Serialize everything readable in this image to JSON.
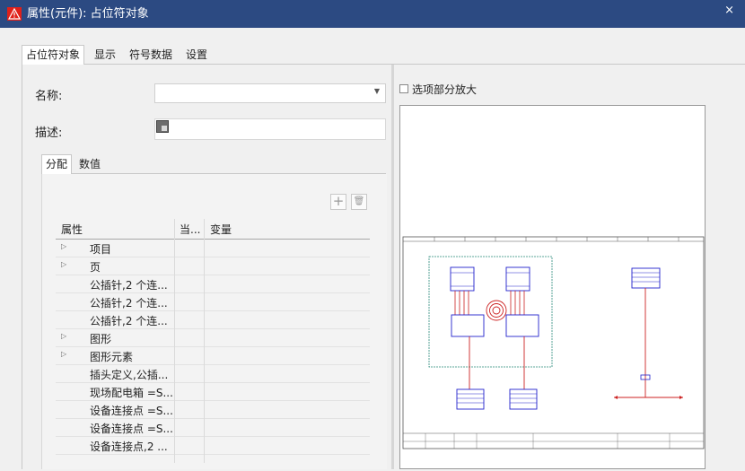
{
  "window": {
    "title": "属性(元件): 占位符对象",
    "close_glyph": "×"
  },
  "tabs": [
    {
      "label": "占位符对象",
      "active": true
    },
    {
      "label": "显示"
    },
    {
      "label": "符号数据"
    },
    {
      "label": "设置"
    }
  ],
  "form": {
    "name_label": "名称:",
    "name_value": "",
    "description_label": "描述:",
    "description_value": ""
  },
  "subtabs": [
    {
      "label": "分配",
      "active": true
    },
    {
      "label": "数值"
    }
  ],
  "toolbar": {
    "add_glyph": "+",
    "delete_glyph": "🗑"
  },
  "grid": {
    "headers": [
      "属性",
      "当...",
      "变量"
    ],
    "rows": [
      {
        "label": "项目",
        "expandable": true
      },
      {
        "label": "页",
        "expandable": true
      },
      {
        "label": "公插针,2 个连..."
      },
      {
        "label": "公插针,2 个连..."
      },
      {
        "label": "公插针,2 个连..."
      },
      {
        "label": "图形",
        "expandable": true
      },
      {
        "label": "图形元素",
        "expandable": true
      },
      {
        "label": "插头定义,公插..."
      },
      {
        "label": "现场配电箱 =S..."
      },
      {
        "label": "设备连接点 =S..."
      },
      {
        "label": "设备连接点 =S..."
      },
      {
        "label": "设备连接点,2 ..."
      }
    ]
  },
  "preview": {
    "zoom_checkbox_label": "选项部分放大",
    "zoom_checked": false
  },
  "colors": {
    "titlebar": "#2c4a82",
    "schematic_blue": "#2222cc",
    "schematic_red": "#cc2222",
    "boundary_teal": "#2a8a7a",
    "warning_red": "#e0201a"
  }
}
